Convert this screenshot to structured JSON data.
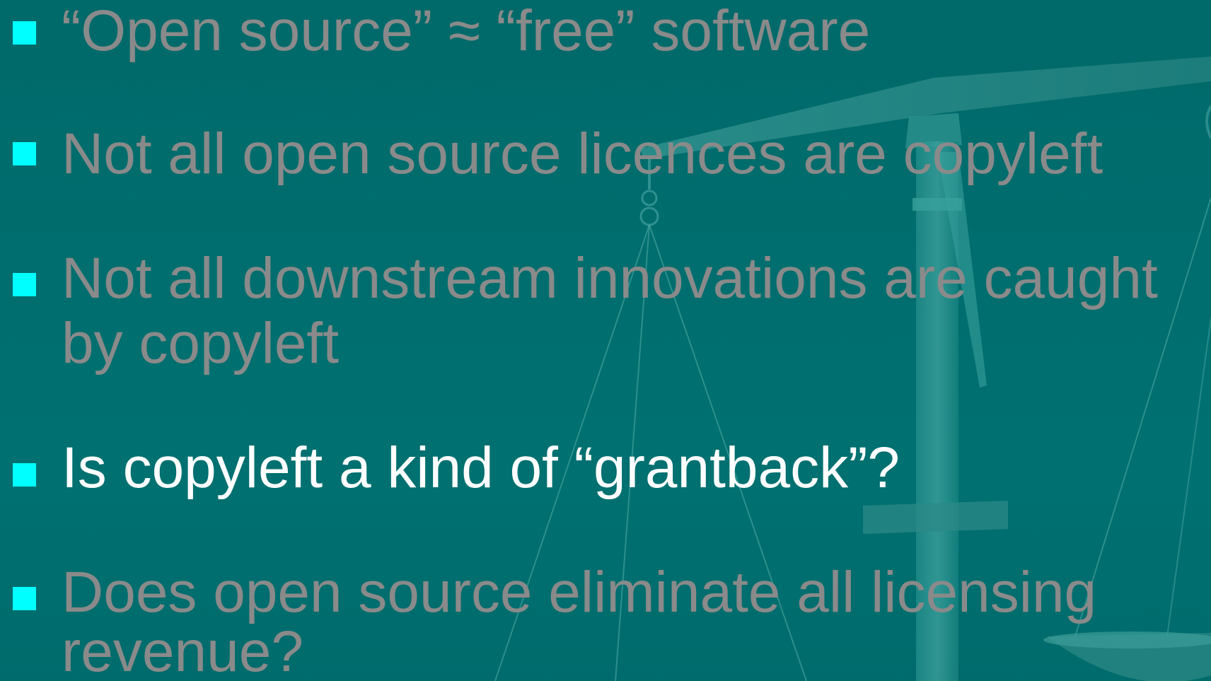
{
  "slide": {
    "bullets": [
      {
        "lines": [
          "“Open source” ≈ “free” software"
        ],
        "state": "dimmed"
      },
      {
        "lines": [
          "Not all open source licences are copyleft"
        ],
        "state": "dimmed"
      },
      {
        "lines": [
          "Not all downstream innovations are caught",
          "by copyleft"
        ],
        "state": "dimmed"
      },
      {
        "lines": [
          "Is copyleft a kind of “grantback”?"
        ],
        "state": "active"
      },
      {
        "lines": [
          "Does open source eliminate all licensing",
          "revenue?"
        ],
        "state": "dimmed"
      }
    ]
  },
  "theme": {
    "background": "#006e6e",
    "bullet_color": "#00ffff",
    "dimmed_text_color": "#8a8a8a",
    "active_text_color": "#ffffff",
    "background_image": "scales-of-justice"
  }
}
